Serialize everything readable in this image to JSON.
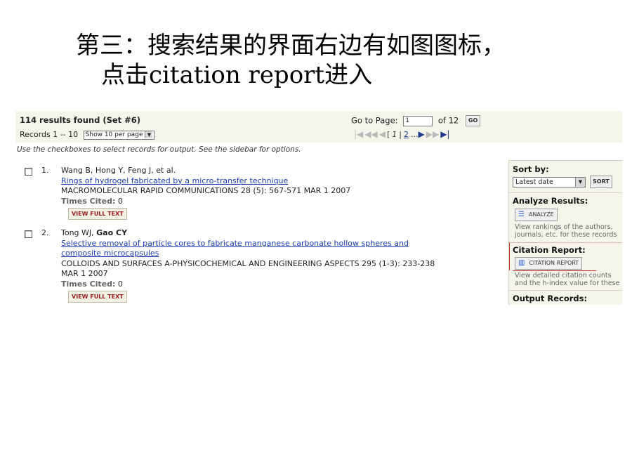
{
  "slide": {
    "title_line1": "第三：搜索结果的界面右边有如图图标，",
    "title_line2": "点击citation report进入"
  },
  "results": {
    "found": "114 results found (Set #6)",
    "records_label": "Records 1 -- 10",
    "per_page": "Show 10 per page",
    "goto_label": "Go to Page:",
    "page_value": "1",
    "of_pages": "of 12",
    "go_label": "GO",
    "pager": {
      "current": "1",
      "next": "2",
      "ellipsis": "..."
    },
    "instructions": "Use the checkboxes to select records for output. See the sidebar for options."
  },
  "records": [
    {
      "num": "1.",
      "authors": "Wang B, Hong Y, Feng J, et al.",
      "authors_bold": "",
      "title": "Rings of hydrogel fabricated by a micro-transfer technique",
      "title_line2": "",
      "source": "MACROMOLECULAR RAPID COMMUNICATIONS 28 (5): 567-571 MAR 1 2007",
      "source_line2": "",
      "times_cited_label": "Times Cited:",
      "times_cited": "0",
      "full_text": "VIEW FULL TEXT"
    },
    {
      "num": "2.",
      "authors": "Tong WJ, ",
      "authors_bold": "Gao CY",
      "title": "Selective removal of particle cores to fabricate manganese carbonate hollow spheres and",
      "title_line2": "composite microcapsules",
      "source": "COLLOIDS AND SURFACES A-PHYSICOCHEMICAL AND ENGINEERING ASPECTS 295 (1-3): 233-238",
      "source_line2": "MAR 1 2007",
      "times_cited_label": "Times Cited:",
      "times_cited": "0",
      "full_text": "VIEW FULL TEXT"
    }
  ],
  "sidebar": {
    "sort_label": "Sort by:",
    "sort_value": "Latest date",
    "sort_button": "SORT",
    "analyze_label": "Analyze Results:",
    "analyze_button": "ANALYZE",
    "analyze_desc1": "View rankings of the authors,",
    "analyze_desc2": "journals, etc. for these records",
    "citation_label": "Citation Report:",
    "citation_button": "CITATION REPORT",
    "citation_desc1": "View detailed citation counts",
    "citation_desc2": "and the h-index value for these",
    "output_label": "Output Records:"
  },
  "icons": {
    "first_page": "first-page-icon",
    "prev_group": "prev-group-icon",
    "prev_page": "prev-page-icon",
    "next_page": "next-page-icon",
    "next_group": "next-group-icon",
    "last_page": "last-page-icon",
    "analyze": "list-lines-icon",
    "citation": "bar-chart-icon"
  },
  "colors": {
    "link": "#1a3cb3",
    "panel_bg": "#f6f5ec",
    "fulltext_text": "#9a2020",
    "highlight": "#c0392b"
  }
}
